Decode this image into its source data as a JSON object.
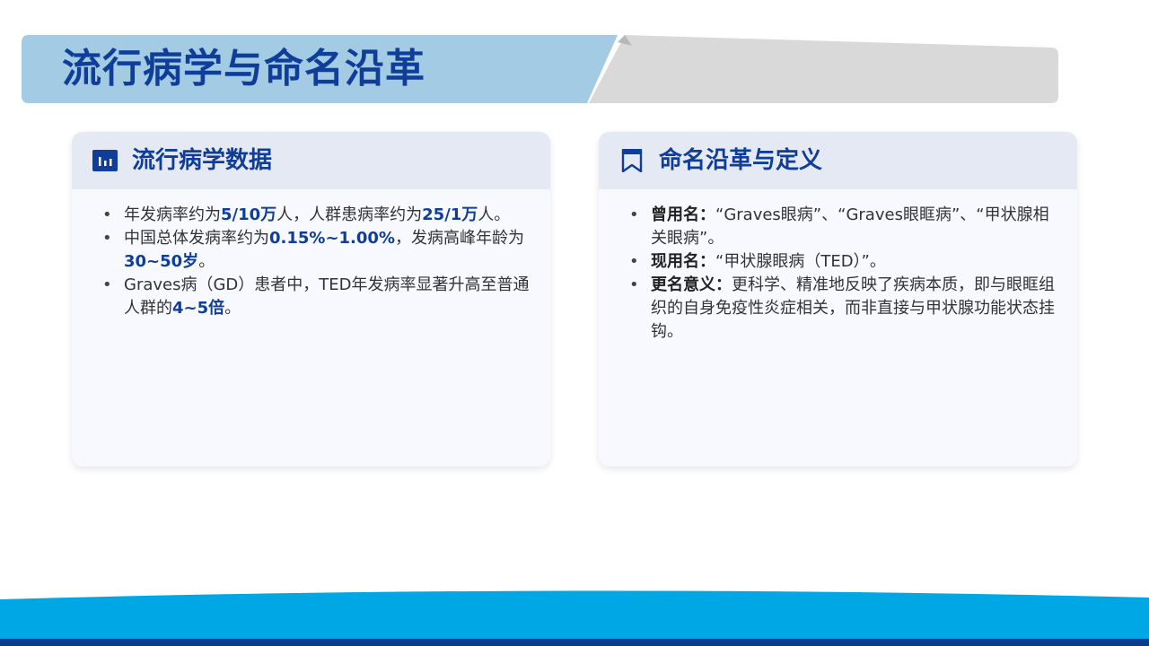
{
  "page": {
    "title": "流行病学与命名沿革"
  },
  "left_card": {
    "title": "流行病学数据",
    "icon": "bar-chart-icon",
    "items": [
      {
        "t1": "年发病率约为",
        "h1": "5/10万",
        "t2": "人，人群患病率约为",
        "h2": "25/1万",
        "t3": "人。"
      },
      {
        "t1": "中国总体发病率约为",
        "h1": "0.15%~1.00%",
        "t2": "，发病高峰年龄为",
        "h2": "30~50岁",
        "t3": "。"
      },
      {
        "t1": "Graves病（GD）患者中，TED年发病率显著升高至普通人群的",
        "h1": "4~5倍",
        "t2": "。"
      }
    ]
  },
  "right_card": {
    "title": "命名沿革与定义",
    "icon": "bookmark-icon",
    "items": [
      {
        "label": "曾用名：",
        "text": "“Graves眼病”、“Graves眼眶病”、“甲状腺相关眼病”。"
      },
      {
        "label": "现用名：",
        "text": "“甲状腺眼病（TED）”。"
      },
      {
        "label": "更名意义：",
        "text": "更科学、精准地反映了疾病本质，即与眼眶组织的自身免疫性炎症相关，而非直接与甲状腺功能状态挂钩。"
      }
    ]
  },
  "colors": {
    "title_blue": "#0f3e9a",
    "title_band_light": "#a3cbe3",
    "title_band_gray": "#d9d9d9",
    "card_header": "#e4e9f4",
    "footer_light_blue": "#00a7e5",
    "footer_dark_blue": "#0a3d91"
  }
}
